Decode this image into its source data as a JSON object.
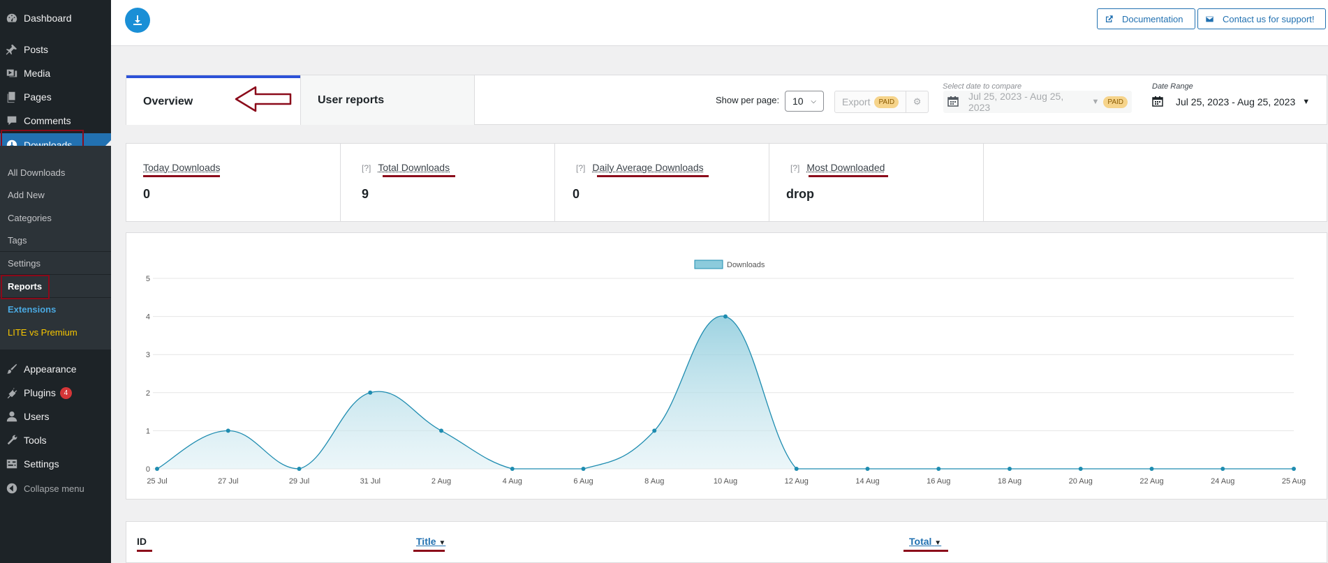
{
  "sidebar": {
    "dashboard": "Dashboard",
    "posts": "Posts",
    "media": "Media",
    "pages": "Pages",
    "comments": "Comments",
    "downloads": "Downloads",
    "submenu": {
      "all_downloads": "All Downloads",
      "add_new": "Add New",
      "categories": "Categories",
      "tags": "Tags",
      "settings": "Settings",
      "reports": "Reports",
      "extensions": "Extensions",
      "lite_vs_premium": "LITE vs Premium"
    },
    "appearance": "Appearance",
    "plugins": "Plugins",
    "plugins_badge": "4",
    "users": "Users",
    "tools": "Tools",
    "settings": "Settings",
    "collapse": "Collapse menu"
  },
  "header": {
    "documentation": "Documentation",
    "contact": "Contact us for support!"
  },
  "tabs": {
    "overview": "Overview",
    "user_reports": "User reports"
  },
  "controls": {
    "per_page_label": "Show per page:",
    "per_page_value": "10",
    "export": "Export",
    "paid": "PAID",
    "compare_hint": "Select date to compare",
    "compare_value": "Jul 25, 2023 - Aug 25, 2023",
    "date_range_label": "Date Range",
    "date_range_value": "Jul 25, 2023 - Aug 25, 2023"
  },
  "stats": [
    {
      "label": "Today Downloads",
      "value": "0",
      "help": ""
    },
    {
      "label": "Total Downloads",
      "value": "9",
      "help": "[?]"
    },
    {
      "label": "Daily Average Downloads",
      "value": "0",
      "help": "[?]"
    },
    {
      "label": "Most Downloaded",
      "value": "drop",
      "help": "[?]"
    }
  ],
  "chart_data": {
    "type": "area",
    "title": "",
    "xlabel": "",
    "ylabel": "",
    "legend": "top-center",
    "grid": true,
    "ylim": [
      0,
      5
    ],
    "yticks": [
      0,
      1,
      2,
      3,
      4,
      5
    ],
    "xtick_labels": [
      "25 Jul",
      "27 Jul",
      "29 Jul",
      "31 Jul",
      "2 Aug",
      "4 Aug",
      "6 Aug",
      "8 Aug",
      "10 Aug",
      "12 Aug",
      "14 Aug",
      "16 Aug",
      "18 Aug",
      "20 Aug",
      "22 Aug",
      "24 Aug",
      "25 Aug"
    ],
    "series": [
      {
        "name": "Downloads",
        "values": [
          0,
          1,
          0,
          2,
          1,
          0,
          0,
          1,
          4,
          0,
          0,
          0,
          0,
          0,
          0,
          0,
          0
        ]
      }
    ],
    "colors": {
      "line": "#1e8cb0",
      "fill": "#8ccbdc",
      "legend_fill": "#8ccbdc"
    }
  },
  "table": {
    "id": "ID",
    "title": "Title",
    "total": "Total"
  }
}
